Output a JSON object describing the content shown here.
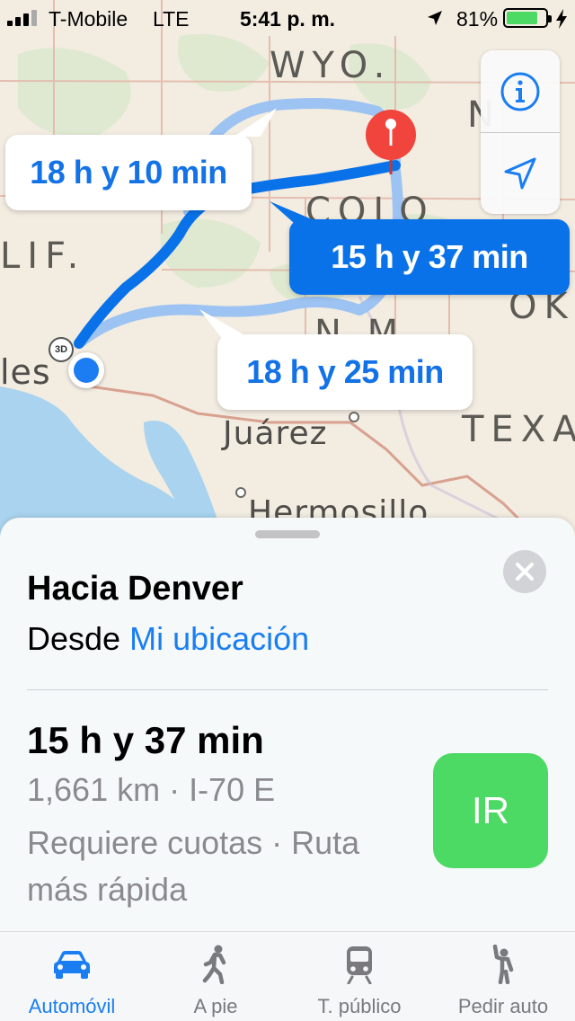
{
  "status_bar": {
    "carrier": "T-Mobile",
    "network": "LTE",
    "time": "5:41 p. m.",
    "battery_percent": "81%",
    "battery_level": 0.81
  },
  "map": {
    "region_labels": {
      "wyo": "WYO.",
      "colo": "COLO",
      "calif": "LIF.",
      "nm": "N.M",
      "texas": "TEXA",
      "ok": "OK",
      "n_top": "N",
      "la": "les"
    },
    "city_labels": {
      "juarez": "Juárez",
      "hermosillo": "Hermosillo"
    },
    "badge_3d": "3D"
  },
  "routes": {
    "alt_north": "18 h y 10 min",
    "main": "15 h y 37 min",
    "alt_south": "18 h y 25 min"
  },
  "card": {
    "title": "Hacia Denver",
    "from_prefix": "Desde ",
    "from_link": "Mi ubicación",
    "route_time": "15 h y 37 min",
    "route_meta": "1,661 km · I-70 E",
    "route_notes": "Requiere cuotas · Ruta más rápida",
    "go_label": "IR"
  },
  "tabs": [
    {
      "label": "Automóvil",
      "icon": "car-icon",
      "active": true
    },
    {
      "label": "A pie",
      "icon": "walking-icon",
      "active": false
    },
    {
      "label": "T. público",
      "icon": "train-icon",
      "active": false
    },
    {
      "label": "Pedir auto",
      "icon": "hailing-icon",
      "active": false
    }
  ],
  "colors": {
    "accent": "#1a7ef2",
    "route_main": "#0a72e8",
    "route_alt": "#9cc3f2",
    "go": "#4cd964",
    "destination_pin": "#f0443c"
  }
}
